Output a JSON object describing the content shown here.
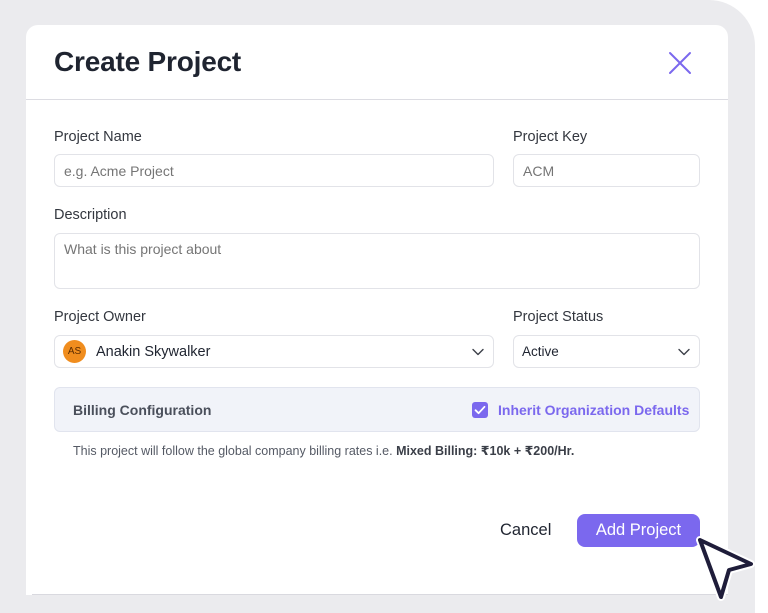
{
  "dialog": {
    "title": "Create Project"
  },
  "fields": {
    "project_name": {
      "label": "Project Name",
      "placeholder": "e.g. Acme Project"
    },
    "project_key": {
      "label": "Project Key",
      "placeholder": "ACM"
    },
    "description": {
      "label": "Description",
      "placeholder": "What is this project about"
    },
    "project_owner": {
      "label": "Project Owner",
      "avatar_initials": "AS",
      "value": "Anakin Skywalker"
    },
    "project_status": {
      "label": "Project Status",
      "value": "Active"
    }
  },
  "billing": {
    "title": "Billing Configuration",
    "inherit_label": "Inherit Organization Defaults",
    "inherit_checked": true,
    "note_prefix": "This project will follow the global company billing rates i.e. ",
    "note_bold": "Mixed Billing: ₹10k + ₹200/Hr."
  },
  "actions": {
    "cancel_label": "Cancel",
    "submit_label": "Add Project"
  },
  "colors": {
    "accent": "#7b68ee",
    "avatar": "#f08d1e",
    "backdrop": "#ebebee"
  }
}
